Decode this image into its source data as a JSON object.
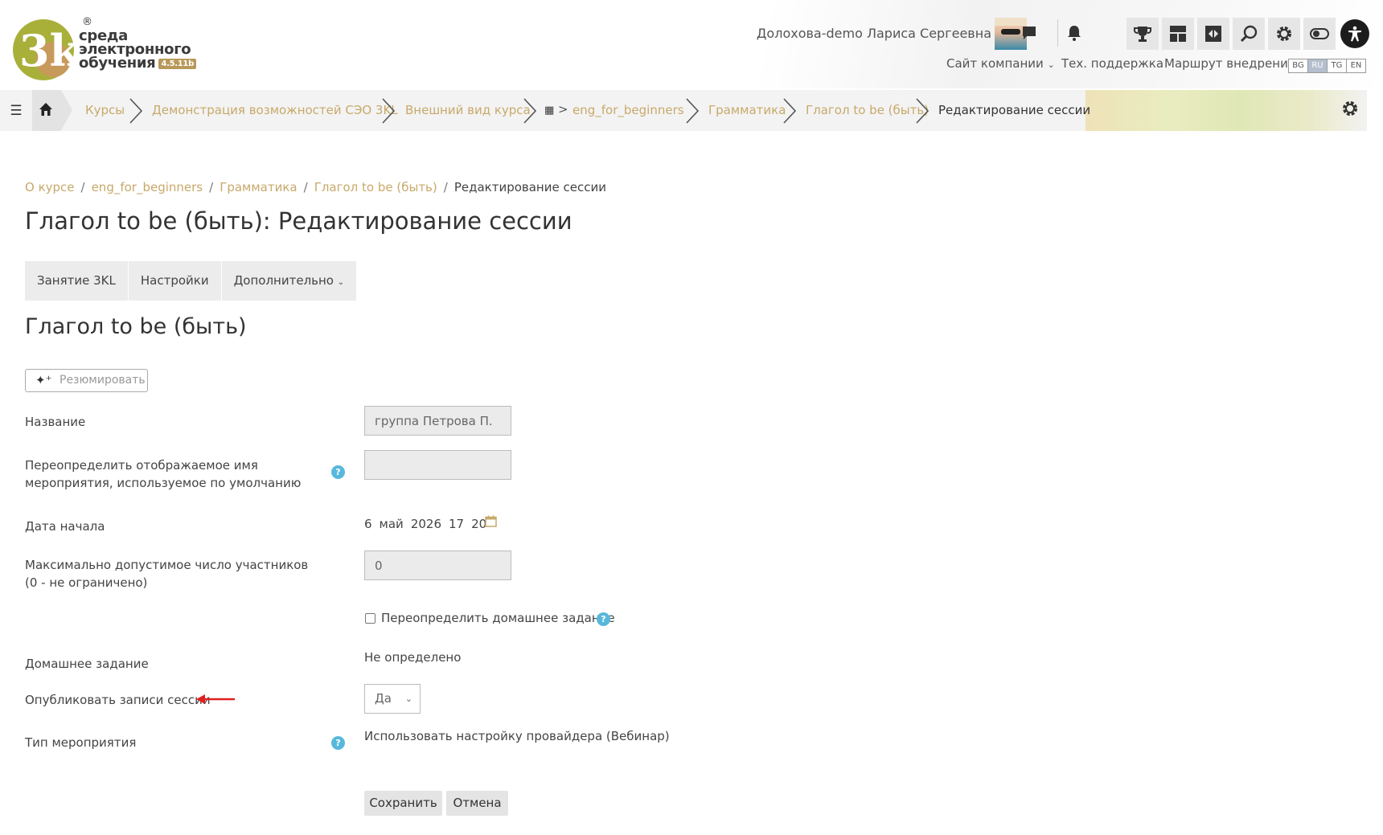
{
  "logo": {
    "line1": "среда",
    "line2": "электронного",
    "line3": "обучения",
    "version": "4.5.11b",
    "reg": "®"
  },
  "header": {
    "user_name": "Долохова-demo Лариса Сергеевна",
    "nav": {
      "company_site": "Сайт компании",
      "support": "Тех. поддержка",
      "route": "Маршрут внедрения"
    },
    "langs": [
      "BG",
      "RU",
      "TG",
      "EN"
    ],
    "active_lang": "RU"
  },
  "breadcrumb_bar": {
    "items": [
      "Курсы",
      "Демонстрация возможностей СЭО 3KL",
      "Внешний вид курса",
      "eng_for_beginners",
      "Грамматика",
      "Глагол to be (быть)",
      "Редактирование сессии"
    ]
  },
  "breadcrumb": {
    "items": [
      "О курсе",
      "eng_for_beginners",
      "Грамматика",
      "Глагол to be (быть)"
    ],
    "current": "Редактирование сессии",
    "separator": "/"
  },
  "page": {
    "title": "Глагол to be (быть): Редактирование сессии",
    "tabs": [
      "Занятие 3KL",
      "Настройки",
      "Дополнительно"
    ],
    "subtitle": "Глагол to be (быть)",
    "resume_button": "Резюмировать"
  },
  "form": {
    "name_label": "Название",
    "name_value": "группа Петрова П.",
    "override_name_label": "Переопределить отображаемое имя мероприятия, используемое по умолчанию",
    "override_name_value": "",
    "start_date_label": "Дата начала",
    "start_date": {
      "day": "6",
      "month": "май",
      "year": "2026",
      "hour": "17",
      "minute": "20"
    },
    "max_participants_label": "Максимально допустимое число участников (0 - не ограничено)",
    "max_participants_value": "0",
    "override_homework_label": "Переопределить домашнее задание",
    "override_homework_checked": false,
    "homework_label": "Домашнее задание",
    "homework_value": "Не определено",
    "publish_label": "Опубликовать записи сессии",
    "publish_value": "Да",
    "event_type_label": "Тип мероприятия",
    "event_type_value": "Использовать настройку провайдера (Вебинар)",
    "save_button": "Сохранить",
    "cancel_button": "Отмена"
  },
  "colors": {
    "link_gold": "#c8a96a",
    "help_blue": "#58b8dc",
    "annotation_red": "#e02020",
    "active_lang": "#b4bfce"
  }
}
